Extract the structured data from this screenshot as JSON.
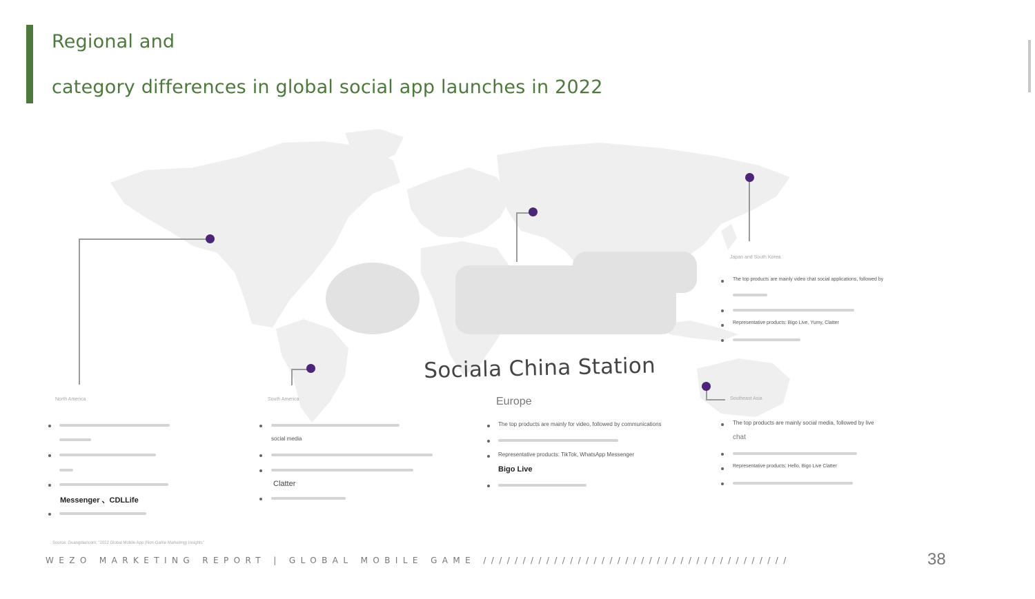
{
  "title": {
    "line1": "Regional and",
    "line2": "category differences in global social app launches in 2022"
  },
  "map_heading": {
    "title": "Sociala China Station",
    "subtitle": "Europe"
  },
  "regions": {
    "north_america": {
      "name": "North America",
      "rep_products": "Messenger 、CDLLife"
    },
    "south_america": {
      "name": "South America",
      "item1_cont": "social media",
      "rep_products": "Clatter"
    },
    "europe": {
      "item1": "The top products are mainly for video, followed by communications",
      "rep_label": "Representative products: TikTok, WhatsApp Messenger",
      "rep_products": "Bigo Live"
    },
    "japan_korea": {
      "name": "Japan and South Korea",
      "item1": "The top products are mainly video chat social applications, followed by",
      "rep_label": "Representative products: Bigo Live, Yumy, Clatter"
    },
    "southeast_asia": {
      "name": "Southeast Asia",
      "item1": "The top products are mainly social media, followed by live",
      "item1_cont": "chat",
      "rep_label": "Representative products: Hello, Bigo Live Clatter"
    }
  },
  "source": "Source: Guangdiancom, \"2022 Global Mobile App (Non-Game Marketing) Insights\"",
  "footer": "WEZO MARKETING REPORT | GLOBAL MOBILE GAME ///////////////////////////////////////",
  "page_number": "38",
  "colors": {
    "accent_green": "#4d7a3c",
    "pin_purple": "#4b2578"
  }
}
